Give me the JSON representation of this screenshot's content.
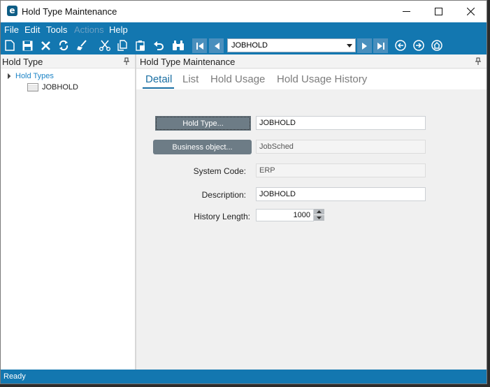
{
  "window": {
    "title": "Hold Type Maintenance",
    "logo_letter": "e"
  },
  "menu": [
    {
      "label": "File",
      "enabled": true
    },
    {
      "label": "Edit",
      "enabled": true
    },
    {
      "label": "Tools",
      "enabled": true
    },
    {
      "label": "Actions",
      "enabled": false
    },
    {
      "label": "Help",
      "enabled": true
    }
  ],
  "toolbar": {
    "icons": [
      "new-icon",
      "save-icon",
      "delete-icon",
      "refresh-icon",
      "clear-icon",
      "cut-icon",
      "copy-icon",
      "paste-icon",
      "undo-icon",
      "search-icon"
    ],
    "record_selector": {
      "value": "JOBHOLD"
    },
    "nav_icons": [
      "first-record-icon",
      "previous-record-icon",
      "next-record-icon",
      "last-record-icon",
      "back-icon",
      "forward-icon",
      "home-icon"
    ]
  },
  "left_panel": {
    "title": "Hold Type",
    "tree": {
      "root_label": "Hold Types",
      "node_label": "JOBHOLD"
    }
  },
  "right_panel": {
    "title": "Hold Type Maintenance",
    "tabs": [
      {
        "label": "Detail",
        "active": true
      },
      {
        "label": "List",
        "active": false
      },
      {
        "label": "Hold Usage",
        "active": false
      },
      {
        "label": "Hold Usage History",
        "active": false
      }
    ],
    "form": {
      "hold_type_button": "Hold Type...",
      "hold_type_value": "JOBHOLD",
      "business_object_button": "Business object...",
      "business_object_value": "JobSched",
      "system_code_label": "System Code:",
      "system_code_value": "ERP",
      "description_label": "Description:",
      "description_value": "JOBHOLD",
      "history_length_label": "History Length:",
      "history_length_value": "1000"
    }
  },
  "status": {
    "text": "Ready"
  },
  "colors": {
    "accent": "#1377b0",
    "link": "#1d84c6",
    "active_tab": "#1a6fa3",
    "button": "#6d7c86"
  }
}
